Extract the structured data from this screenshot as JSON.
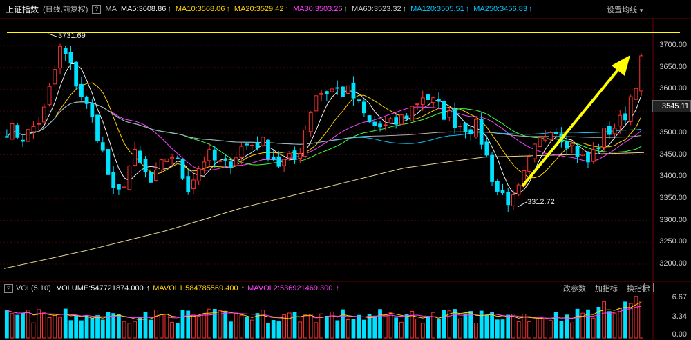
{
  "header": {
    "index_name": "上证指数",
    "period": "(日线,前复权)",
    "help_icon": "?",
    "ma_label": "MA",
    "ma_items": [
      {
        "label": "MA5:3608.86",
        "color": "#f0f0f0"
      },
      {
        "label": "MA10:3568.06",
        "color": "#ffd400"
      },
      {
        "label": "MA20:3529.42",
        "color": "#ffd400"
      },
      {
        "label": "MA30:3503.26",
        "color": "#ff40ff"
      },
      {
        "label": "MA60:3523.32",
        "color": "#d0d0d0"
      },
      {
        "label": "MA120:3505.51",
        "color": "#00c8ff"
      },
      {
        "label": "MA250:3456.83",
        "color": "#00c8ff"
      }
    ],
    "arrow_colors": [
      "#f0f0f0",
      "#ffd400",
      "#ffd400",
      "#40ff40",
      "#d0d0d0",
      "#00c8ff",
      "#00c8ff"
    ],
    "settings_label": "设置均线"
  },
  "price_axis": {
    "ticks": [
      "3700.00",
      "3650.00",
      "3600.00",
      "3550.00",
      "3500.00",
      "3450.00",
      "3400.00",
      "3350.00",
      "3300.00",
      "3250.00",
      "3200.00"
    ],
    "last_price": "3545.11"
  },
  "annotations": {
    "high": "3731.69",
    "low": "3312.72"
  },
  "volume_panel": {
    "help_icon": "?",
    "name": "VOL(5,10)",
    "volume_label": "VOLUME:547721874.000",
    "mavol1_label": "MAVOL1:584785569.400",
    "mavol2_label": "MAVOL2:536921469.300",
    "buttons": [
      "改参数",
      "加指标",
      "换指标"
    ],
    "close_icon": "×",
    "axis_ticks": [
      "6.67",
      "3.34",
      "0.00"
    ]
  },
  "colors": {
    "up": "#ff3030",
    "down": "#00e0ff",
    "yellow_line": "#ffff00"
  },
  "chart_data": {
    "type": "candlestick",
    "ylim": [
      3170,
      3760
    ],
    "high_annotation": 3731.69,
    "low_annotation": 3312.72,
    "horizontal_line": 3730,
    "anchors": [
      3510,
      3490,
      3540,
      3700,
      3600,
      3500,
      3340,
      3450,
      3380,
      3460,
      3380,
      3450,
      3420,
      3470,
      3480,
      3430,
      3440,
      3590,
      3600,
      3590,
      3520,
      3510,
      3540,
      3590,
      3550,
      3520,
      3510,
      3370,
      3340,
      3450,
      3520,
      3480,
      3430,
      3500,
      3530,
      3660
    ],
    "n_candles": 120,
    "ma_series": [
      {
        "period": 5,
        "color": "#f0f0f0"
      },
      {
        "period": 10,
        "color": "#ffd400"
      },
      {
        "period": 20,
        "color": "#ff40ff"
      },
      {
        "period": 30,
        "color": "#40ff40"
      },
      {
        "period": 60,
        "color": "#00c8ff"
      },
      {
        "period": 120,
        "color": "#b0b0b0"
      }
    ],
    "ma250_points": [
      3190,
      3230,
      3275,
      3330,
      3375,
      3420,
      3445,
      3450,
      3455
    ],
    "volume_ylim": [
      0,
      6.67
    ]
  }
}
